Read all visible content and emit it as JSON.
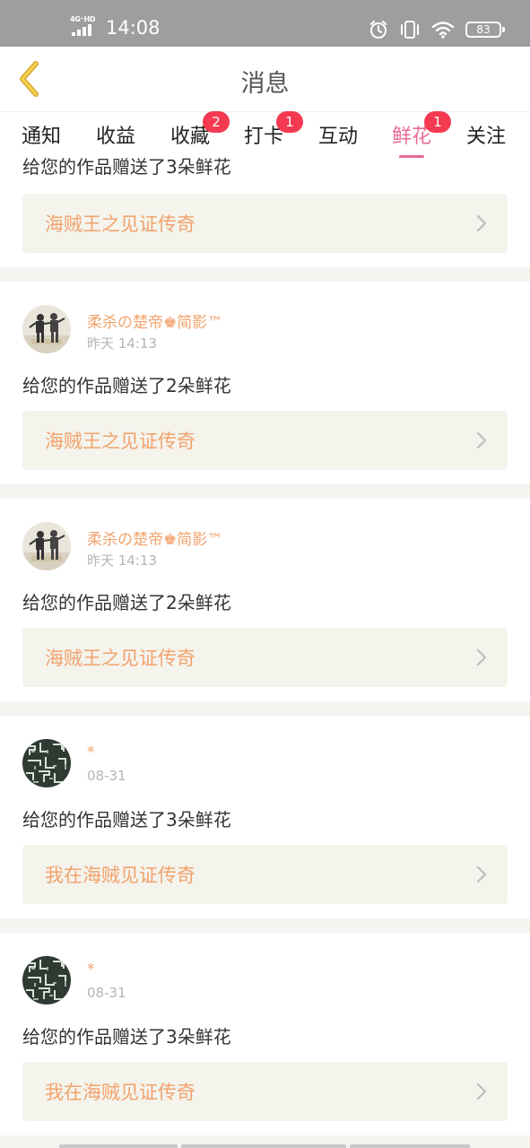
{
  "status_bar": {
    "network": "4G⁺HD",
    "time": "14:08",
    "battery": "83",
    "icons": [
      "alarm-icon",
      "vibrate-icon",
      "wifi-icon",
      "battery-icon"
    ]
  },
  "header": {
    "title": "消息",
    "back_icon": "chevron-left-icon"
  },
  "tabs": [
    {
      "label": "通知",
      "badge": ""
    },
    {
      "label": "收益",
      "badge": ""
    },
    {
      "label": "收藏",
      "badge": "2"
    },
    {
      "label": "打卡",
      "badge": "1"
    },
    {
      "label": "互动",
      "badge": ""
    },
    {
      "label": "鲜花",
      "badge": "1",
      "active": true
    },
    {
      "label": "关注",
      "badge": ""
    }
  ],
  "cards": [
    {
      "message": "给您的作品赠送了3朵鲜花",
      "work_title": "海贼王之见证传奇",
      "partial": true
    },
    {
      "user_name": "柔杀の楚帝♚简影™",
      "time": "昨天 14:13",
      "message": "给您的作品赠送了2朵鲜花",
      "work_title": "海贼王之见证传奇",
      "avatar": "photo"
    },
    {
      "user_name": "柔杀の楚帝♚简影™",
      "time": "昨天 14:13",
      "message": "给您的作品赠送了2朵鲜花",
      "work_title": "海贼王之见证传奇",
      "avatar": "photo"
    },
    {
      "user_name": "*",
      "time": "08-31",
      "message": "给您的作品赠送了3朵鲜花",
      "work_title": "我在海贼见证传奇",
      "avatar": "pattern"
    },
    {
      "user_name": "*",
      "time": "08-31",
      "message": "给您的作品赠送了3朵鲜花",
      "work_title": "我在海贼见证传奇",
      "avatar": "pattern"
    }
  ],
  "colors": {
    "accent_pink": "#e86b95",
    "name_orange": "#f2a36e",
    "badge_red": "#f43a51",
    "status_bar_gray": "#9e9e9e",
    "link_background": "#f4f3ec"
  }
}
